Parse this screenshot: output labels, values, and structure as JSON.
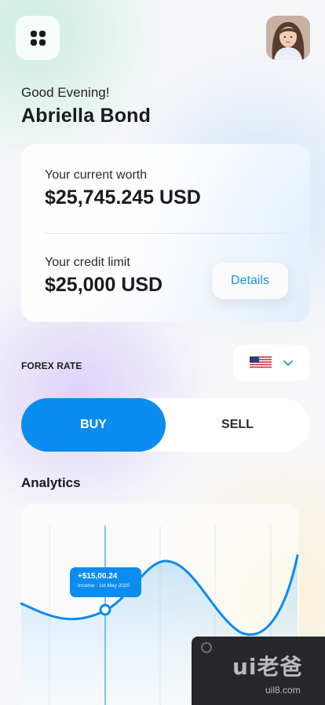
{
  "header": {
    "menu_icon": "grid-menu-icon",
    "avatar": "profile-photo"
  },
  "greeting": "Good Evening!",
  "user_name": "Abriella Bond",
  "worth_card": {
    "worth_label": "Your current worth",
    "worth_value": "$25,745.245 USD",
    "credit_label": "Your credit limit",
    "credit_value": "$25,000 USD",
    "details_label": "Details"
  },
  "forex": {
    "label": "FOREX RATE",
    "currency_flag": "us-flag-icon",
    "dropdown_icon": "chevron-down-icon"
  },
  "trade_toggle": {
    "buy_label": "BUY",
    "sell_label": "SELL",
    "active": "BUY"
  },
  "analytics": {
    "title": "Analytics",
    "tooltip": {
      "value": "+$15,00.24",
      "subtitle": "Income - 1st May 2020"
    }
  },
  "watermark": {
    "text": "ui老爸",
    "url": "uil8.com"
  },
  "colors": {
    "accent": "#0a8cf0",
    "details_text": "#1d93d6",
    "text_primary": "#1b1b1f"
  }
}
